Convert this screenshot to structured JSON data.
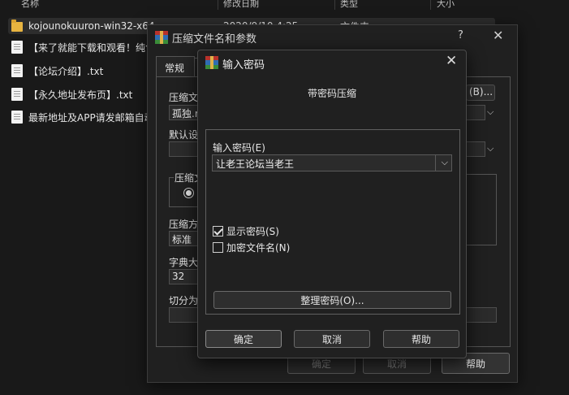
{
  "explorer": {
    "columns": [
      "名称",
      "修改日期",
      "类型",
      "大小"
    ],
    "files": [
      {
        "name": "kojounokuuron-win32-x64",
        "date": "2020/9/10 4:25",
        "type": "文件夹",
        "icon": "folder-icon"
      },
      {
        "name": "【来了就能下载和观看！纯色",
        "icon": "text-file-icon"
      },
      {
        "name": "【论坛介绍】.txt",
        "icon": "text-file-icon"
      },
      {
        "name": "【永久地址发布页】.txt",
        "icon": "text-file-icon"
      },
      {
        "name": "最新地址及APP请发邮箱自动",
        "icon": "text-file-icon"
      }
    ]
  },
  "archive_dialog": {
    "title": "压缩文件名和参数",
    "help": "?",
    "close": "✕",
    "tab_general": "常规",
    "archive_name_label": "压缩文",
    "archive_name_value": "孤独.r",
    "browse_button": "(B)...",
    "default_settings_label": "默认设",
    "format_label": "压缩文",
    "method_label": "压缩方",
    "method_value": "标准",
    "dict_label": "字典大",
    "dict_value": "32",
    "split_label": "切分为",
    "ok": "确定",
    "cancel": "取消",
    "help_button": "帮助"
  },
  "password_dialog": {
    "title": "输入密码",
    "close": "✕",
    "caption": "带密码压缩",
    "password_label": "输入密码(E)",
    "password_value": "让老王论坛当老王",
    "show_password_label": "显示密码(S)",
    "show_password_checked": true,
    "encrypt_names_label": "加密文件名(N)",
    "encrypt_names_checked": false,
    "organize_button": "整理密码(O)...",
    "ok": "确定",
    "cancel": "取消",
    "help": "帮助"
  },
  "colors": {
    "background": "#191919",
    "dialog": "#202020",
    "folder": "#e8b440"
  }
}
